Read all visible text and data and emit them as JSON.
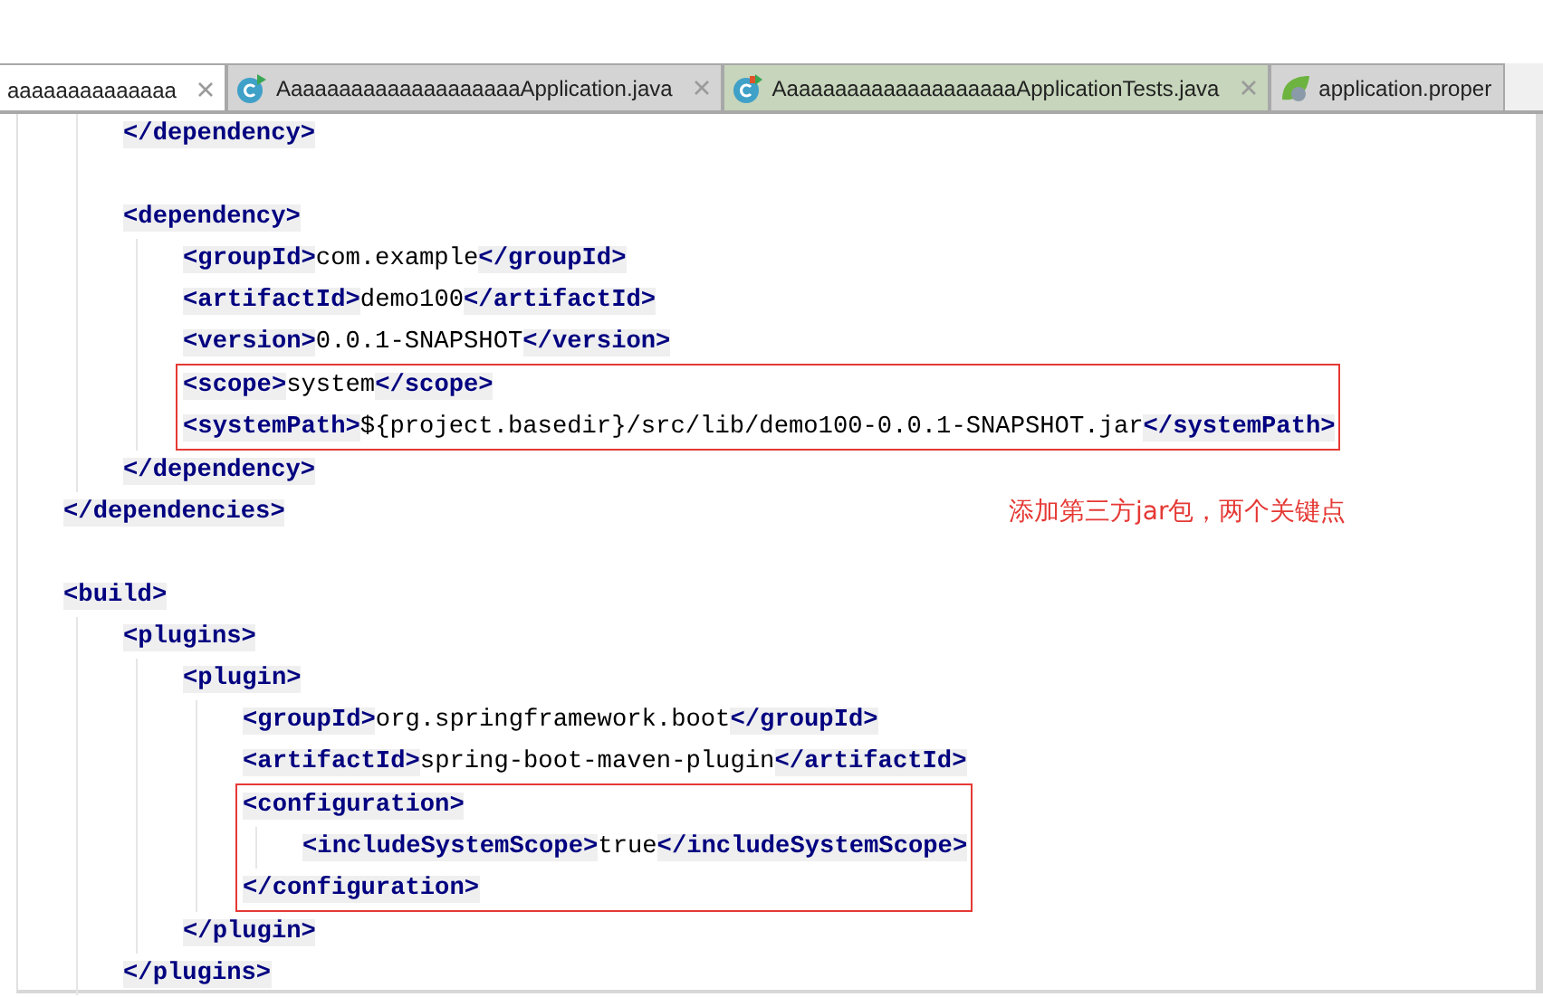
{
  "tabs": [
    {
      "label": "aaaaaaaaaaaaaa",
      "kind": "plain",
      "selected": true,
      "closable": true,
      "color": "#ffffff"
    },
    {
      "label": "AaaaaaaaaaaaaaaaaaaaApplication.java",
      "kind": "class",
      "selected": false,
      "closable": true,
      "color": "#d4d4d4"
    },
    {
      "label": "AaaaaaaaaaaaaaaaaaaaApplicationTests.java",
      "kind": "test",
      "selected": false,
      "closable": true,
      "color": "#c6d5bb"
    },
    {
      "label": "application.proper",
      "kind": "spring",
      "selected": false,
      "closable": false,
      "color": "#d4d4d4"
    }
  ],
  "code": [
    {
      "kind": "group",
      "children": [
        {
          "kind": "line",
          "tokens": [
            {
              "kind": "tag",
              "text": "</dependency>"
            }
          ]
        },
        {
          "kind": "blank"
        },
        {
          "kind": "line",
          "tokens": [
            {
              "kind": "tag",
              "text": "<dependency>"
            }
          ],
          "children": [
            {
              "kind": "line",
              "tokens": [
                {
                  "kind": "tag",
                  "text": "<groupId>"
                },
                {
                  "kind": "value",
                  "text": "com.example"
                },
                {
                  "kind": "tag",
                  "text": "</groupId>"
                }
              ]
            },
            {
              "kind": "line",
              "tokens": [
                {
                  "kind": "tag",
                  "text": "<artifactId>"
                },
                {
                  "kind": "value",
                  "text": "demo100"
                },
                {
                  "kind": "tag",
                  "text": "</artifactId>"
                }
              ]
            },
            {
              "kind": "line",
              "tokens": [
                {
                  "kind": "tag",
                  "text": "<version>"
                },
                {
                  "kind": "value",
                  "text": "0.0.1-SNAPSHOT"
                },
                {
                  "kind": "tag",
                  "text": "</version>"
                }
              ]
            },
            {
              "kind": "box",
              "children": [
                {
                  "kind": "line",
                  "tokens": [
                    {
                      "kind": "tag",
                      "text": "<scope>"
                    },
                    {
                      "kind": "value",
                      "text": "system"
                    },
                    {
                      "kind": "tag",
                      "text": "</scope>"
                    }
                  ]
                },
                {
                  "kind": "line",
                  "tokens": [
                    {
                      "kind": "tag",
                      "text": "<systemPath>"
                    },
                    {
                      "kind": "value",
                      "text": "${project.basedir}/src/lib/demo100-0.0.1-SNAPSHOT.jar"
                    },
                    {
                      "kind": "tag",
                      "text": "</systemPath>"
                    }
                  ]
                }
              ]
            }
          ]
        },
        {
          "kind": "line",
          "tokens": [
            {
              "kind": "tag",
              "text": "</dependency>"
            }
          ]
        }
      ]
    },
    {
      "kind": "line",
      "tokens": [
        {
          "kind": "tag",
          "text": "</dependencies>"
        }
      ]
    },
    {
      "kind": "blank"
    },
    {
      "kind": "line",
      "tokens": [
        {
          "kind": "tag",
          "text": "<build>"
        }
      ],
      "children": [
        {
          "kind": "line",
          "tokens": [
            {
              "kind": "tag",
              "text": "<plugins>"
            }
          ],
          "children": [
            {
              "kind": "line",
              "tokens": [
                {
                  "kind": "tag",
                  "text": "<plugin>"
                }
              ],
              "children": [
                {
                  "kind": "line",
                  "tokens": [
                    {
                      "kind": "tag",
                      "text": "<groupId>"
                    },
                    {
                      "kind": "value",
                      "text": "org.springframework.boot"
                    },
                    {
                      "kind": "tag",
                      "text": "</groupId>"
                    }
                  ]
                },
                {
                  "kind": "line",
                  "tokens": [
                    {
                      "kind": "tag",
                      "text": "<artifactId>"
                    },
                    {
                      "kind": "value",
                      "text": "spring-boot-maven-plugin"
                    },
                    {
                      "kind": "tag",
                      "text": "</artifactId>"
                    }
                  ]
                },
                {
                  "kind": "box",
                  "children": [
                    {
                      "kind": "line",
                      "tokens": [
                        {
                          "kind": "tag",
                          "text": "<configuration>"
                        }
                      ],
                      "children": [
                        {
                          "kind": "line",
                          "tokens": [
                            {
                              "kind": "tag",
                              "text": "<includeSystemScope>"
                            },
                            {
                              "kind": "value",
                              "text": "true"
                            },
                            {
                              "kind": "tag",
                              "text": "</includeSystemScope>"
                            }
                          ]
                        }
                      ]
                    },
                    {
                      "kind": "line",
                      "tokens": [
                        {
                          "kind": "tag",
                          "text": "</configuration>"
                        }
                      ]
                    }
                  ]
                }
              ]
            },
            {
              "kind": "line",
              "tokens": [
                {
                  "kind": "tag",
                  "text": "</plugin>"
                }
              ]
            }
          ]
        },
        {
          "kind": "line",
          "tokens": [
            {
              "kind": "tag",
              "text": "</plugins>"
            }
          ]
        }
      ]
    }
  ],
  "annotation": "添加第三方jar包，两个关键点"
}
